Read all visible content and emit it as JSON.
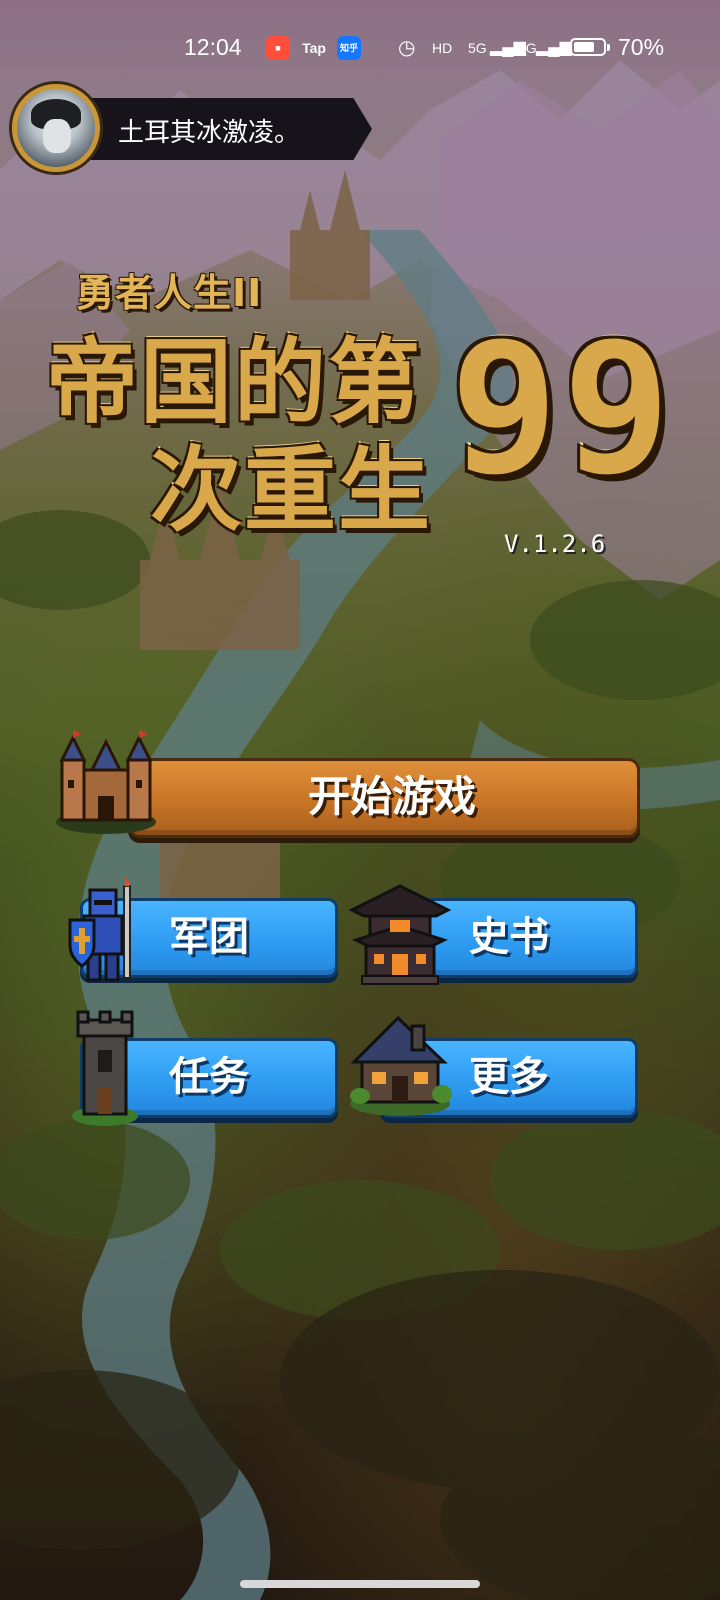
{
  "status_bar": {
    "time": "12:04",
    "apps": {
      "game_center": "game-center-icon",
      "tap": "Tap",
      "zhihu": "知乎"
    },
    "alarm_icon": "alarm-icon",
    "hd_label": "HD",
    "net_5g": "5G",
    "net_4g": "4G",
    "battery_percent": "70%",
    "battery_level": 0.7
  },
  "player": {
    "name": "土耳其冰激凌。",
    "avatar": "avatar-icon"
  },
  "logo": {
    "subtitle": "勇者人生II",
    "line1": "帝国的第",
    "line2": "次重生",
    "number": "99",
    "colors": {
      "gold": "#d9a84a",
      "shadow": "#2a1806"
    }
  },
  "version": "V.1.2.6",
  "buttons": {
    "start": {
      "label": "开始游戏",
      "icon": "castle-icon",
      "color": "#c87527"
    },
    "legion": {
      "label": "军团",
      "icon": "knight-icon",
      "color": "#2f9cf2"
    },
    "history": {
      "label": "史书",
      "icon": "pagoda-icon",
      "color": "#2f9cf2"
    },
    "quest": {
      "label": "任务",
      "icon": "tower-icon",
      "color": "#2f9cf2"
    },
    "more": {
      "label": "更多",
      "icon": "cottage-icon",
      "color": "#2f9cf2"
    }
  }
}
